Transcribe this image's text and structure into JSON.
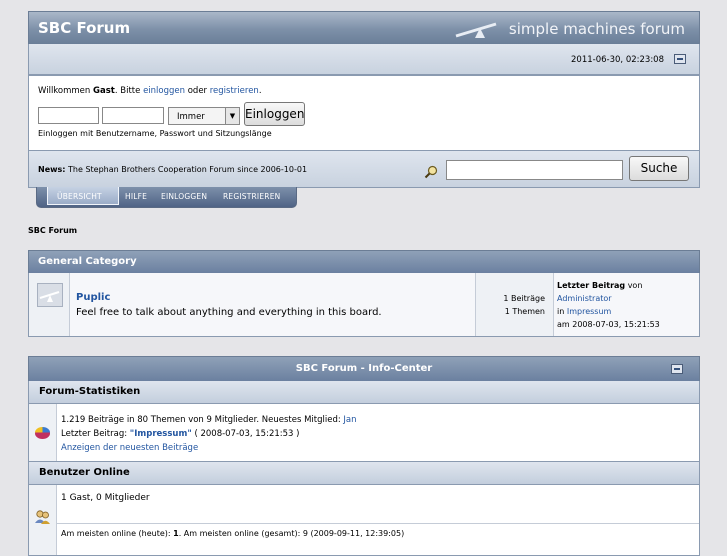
{
  "header": {
    "title": "SBC Forum",
    "brand": "simple machines forum"
  },
  "datebar": {
    "datetime": "2011-06-30, 02:23:08"
  },
  "login": {
    "welcome_prefix": "Willkommen ",
    "guest": "Gast",
    "welcome_mid": ". Bitte ",
    "login_link": "einloggen",
    "or": " oder ",
    "register_link": "registrieren",
    "period": ".",
    "username_value": "",
    "password_value": "",
    "duration_selected": "Immer",
    "submit_label": "Einloggen",
    "hint": "Einloggen mit Benutzername, Passwort und Sitzungslänge"
  },
  "news": {
    "label": "News:",
    "text": " The Stephan Brothers Cooperation Forum since 2006-10-01"
  },
  "search": {
    "value": "",
    "button_label": "Suche"
  },
  "menu": {
    "items": [
      "ÜBERSICHT",
      "HILFE",
      "EINLOGGEN",
      "REGISTRIEREN"
    ]
  },
  "breadcrumb": "SBC Forum",
  "category": {
    "title": "General Category",
    "boards": [
      {
        "name": "Puplic",
        "description": "Feel free to talk about anything and everything in this board.",
        "posts": "1 Beiträge",
        "topics": "1 Themen",
        "last_label": "Letzter Beitrag",
        "last_by": " von",
        "last_author": "Administrator",
        "last_in": "in ",
        "last_topic": "Impressum",
        "last_date": "am 2008-07-03, 15:21:53"
      }
    ]
  },
  "infocenter": {
    "title": "SBC Forum - Info-Center",
    "stats": {
      "heading": "Forum-Statistiken",
      "line1": "1.219 Beiträge in 80 Themen von 9 Mitglieder. Neuestes Mitglied: ",
      "newest_member": "Jan",
      "line2_prefix": "Letzter Beitrag: ",
      "line2_topic": "\"Impressum\"",
      "line2_suffix": " ( 2008-07-03, 15:21:53 )",
      "recent_link": "Anzeigen der neuesten Beiträge"
    },
    "online": {
      "heading": "Benutzer Online",
      "count": "1 Gast, 0 Mitglieder",
      "most_prefix": "Am meisten online (heute): ",
      "most_today": "1",
      "most_suffix": ". Am meisten online (gesamt): 9 (2009-09-11, 12:39:05)"
    }
  },
  "colors": {
    "header_blue": "#7d90a8",
    "link": "#2255a0"
  }
}
